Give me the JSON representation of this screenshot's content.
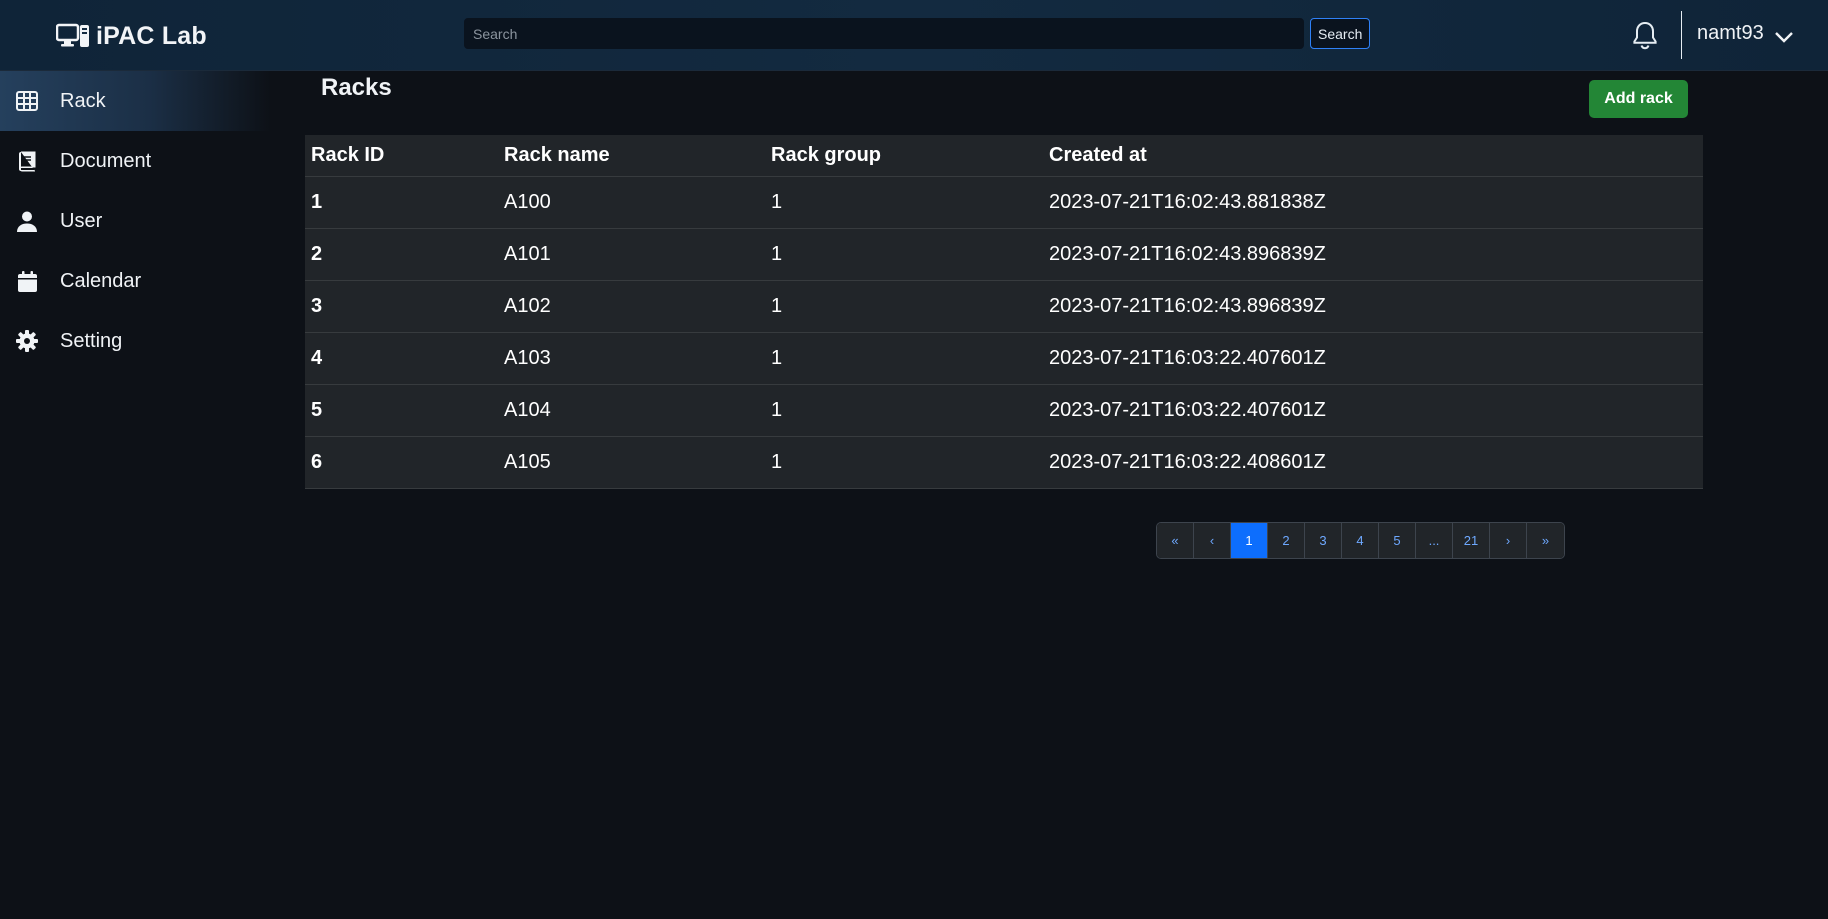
{
  "header": {
    "brand": "iPAC Lab",
    "search_placeholder": "Search",
    "search_button": "Search",
    "username": "namt93"
  },
  "sidebar": {
    "items": [
      {
        "label": "Rack",
        "icon": "table-grid-icon",
        "active": true
      },
      {
        "label": "Document",
        "icon": "book-icon",
        "active": false
      },
      {
        "label": "User",
        "icon": "user-icon",
        "active": false
      },
      {
        "label": "Calendar",
        "icon": "calendar-icon",
        "active": false
      },
      {
        "label": "Setting",
        "icon": "gear-icon",
        "active": false
      }
    ]
  },
  "main": {
    "title": "Racks",
    "add_button": "Add rack",
    "table": {
      "columns": [
        "Rack ID",
        "Rack name",
        "Rack group",
        "Created at"
      ],
      "rows": [
        [
          "1",
          "A100",
          "1",
          "2023-07-21T16:02:43.881838Z"
        ],
        [
          "2",
          "A101",
          "1",
          "2023-07-21T16:02:43.896839Z"
        ],
        [
          "3",
          "A102",
          "1",
          "2023-07-21T16:02:43.896839Z"
        ],
        [
          "4",
          "A103",
          "1",
          "2023-07-21T16:03:22.407601Z"
        ],
        [
          "5",
          "A104",
          "1",
          "2023-07-21T16:03:22.407601Z"
        ],
        [
          "6",
          "A105",
          "1",
          "2023-07-21T16:03:22.408601Z"
        ]
      ]
    },
    "pagination": {
      "items": [
        "«",
        "‹",
        "1",
        "2",
        "3",
        "4",
        "5",
        "...",
        "21",
        "›",
        "»"
      ],
      "active": "1"
    }
  },
  "colors": {
    "background": "#0d1117",
    "header": "#132a40",
    "accent_green": "#238636",
    "accent_blue": "#0d6efd",
    "table_bg": "#212529"
  }
}
